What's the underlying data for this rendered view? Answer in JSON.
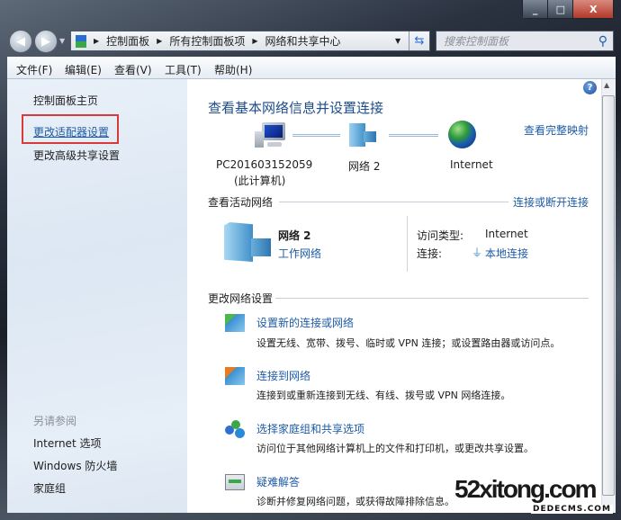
{
  "window": {
    "minimize": "_",
    "maximize": "□",
    "close": "X"
  },
  "nav": {
    "breadcrumbs": [
      "控制面板",
      "所有控制面板项",
      "网络和共享中心"
    ],
    "search_placeholder": "搜索控制面板"
  },
  "menu": [
    "文件(F)",
    "编辑(E)",
    "查看(V)",
    "工具(T)",
    "帮助(H)"
  ],
  "sidebar": {
    "items": [
      "控制面板主页",
      "更改适配器设置",
      "更改高级共享设置"
    ],
    "see_also_header": "另请参阅",
    "see_also": [
      "Internet 选项",
      "Windows 防火墙",
      "家庭组"
    ],
    "highlight_color": "#d83a3a"
  },
  "main": {
    "title": "查看基本网络信息并设置连接",
    "view_full_map": "查看完整映射",
    "map": {
      "computer": "PC201603152059",
      "computer_note": "(此计算机)",
      "network": "网络  2",
      "internet": "Internet"
    },
    "active_networks": {
      "header": "查看活动网络",
      "connect_link": "连接或断开连接",
      "network_name": "网络  2",
      "network_type": "工作网络",
      "access_type_label": "访问类型:",
      "access_type_value": "Internet",
      "connections_label": "连接:",
      "connections_value": "本地连接"
    },
    "change_settings": {
      "header": "更改网络设置",
      "items": [
        {
          "title": "设置新的连接或网络",
          "desc": "设置无线、宽带、拨号、临时或 VPN 连接；或设置路由器或访问点。"
        },
        {
          "title": "连接到网络",
          "desc": "连接到或重新连接到无线、有线、拨号或 VPN 网络连接。"
        },
        {
          "title": "选择家庭组和共享选项",
          "desc": "访问位于其他网络计算机上的文件和打印机，或更改共享设置。"
        },
        {
          "title": "疑难解答",
          "desc": "诊断并修复网络问题，或获得故障排除信息。"
        }
      ]
    }
  },
  "watermark": {
    "main": "52xitong.com",
    "sub": "DEDECMS.COM"
  }
}
